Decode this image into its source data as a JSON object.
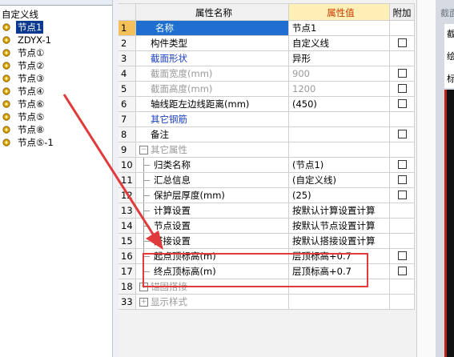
{
  "tree": {
    "root": "自定义线",
    "items": [
      {
        "label": "节点1",
        "selected": true
      },
      {
        "label": "ZDYX-1",
        "selected": false
      },
      {
        "label": "节点①",
        "selected": false
      },
      {
        "label": "节点②",
        "selected": false
      },
      {
        "label": "节点③",
        "selected": false
      },
      {
        "label": "节点④",
        "selected": false
      },
      {
        "label": "节点⑥",
        "selected": false
      },
      {
        "label": "节点⑤",
        "selected": false
      },
      {
        "label": "节点⑧",
        "selected": false
      },
      {
        "label": "节点⑤-1",
        "selected": false
      }
    ]
  },
  "grid": {
    "headers": {
      "name": "属性名称",
      "value": "属性值",
      "add": "附加"
    },
    "rows": [
      {
        "num": "1",
        "name": "名称",
        "value": "节点1",
        "checkbox": false
      },
      {
        "num": "2",
        "name": "构件类型",
        "value": "自定义线",
        "checkbox": true
      },
      {
        "num": "3",
        "name": "截面形状",
        "value": "异形",
        "checkbox": false
      },
      {
        "num": "4",
        "name": "截面宽度(mm)",
        "value": "900",
        "checkbox": true
      },
      {
        "num": "5",
        "name": "截面高度(mm)",
        "value": "1200",
        "checkbox": true
      },
      {
        "num": "6",
        "name": "轴线距左边线距离(mm)",
        "value": "(450)",
        "checkbox": true
      },
      {
        "num": "7",
        "name": "其它钢筋",
        "value": "",
        "checkbox": false
      },
      {
        "num": "8",
        "name": "备注",
        "value": "",
        "checkbox": true
      },
      {
        "num": "9",
        "name": "其它属性",
        "value": "",
        "checkbox": false
      },
      {
        "num": "10",
        "name": "归类名称",
        "value": "(节点1)",
        "checkbox": true
      },
      {
        "num": "11",
        "name": "汇总信息",
        "value": "(自定义线)",
        "checkbox": true
      },
      {
        "num": "12",
        "name": "保护层厚度(mm)",
        "value": "(25)",
        "checkbox": true
      },
      {
        "num": "13",
        "name": "计算设置",
        "value": "按默认计算设置计算",
        "checkbox": false
      },
      {
        "num": "14",
        "name": "节点设置",
        "value": "按默认节点设置计算",
        "checkbox": false
      },
      {
        "num": "15",
        "name": "搭接设置",
        "value": "按默认搭接设置计算",
        "checkbox": false
      },
      {
        "num": "16",
        "name": "起点顶标高(m)",
        "value": "层顶标高+0.7",
        "checkbox": true
      },
      {
        "num": "17",
        "name": "终点顶标高(m)",
        "value": "层顶标高+0.7",
        "checkbox": true
      },
      {
        "num": "18",
        "name": "锚固搭接",
        "value": "",
        "checkbox": false
      },
      {
        "num": "33",
        "name": "显示样式",
        "value": "",
        "checkbox": false
      }
    ]
  },
  "right_panel": {
    "title": "截面",
    "tab": "截",
    "side1": "绘",
    "side2": "标"
  },
  "colors": {
    "selection": "#1e6fd0",
    "header_value": "#c83a00",
    "annotation": "#e03a3a"
  }
}
